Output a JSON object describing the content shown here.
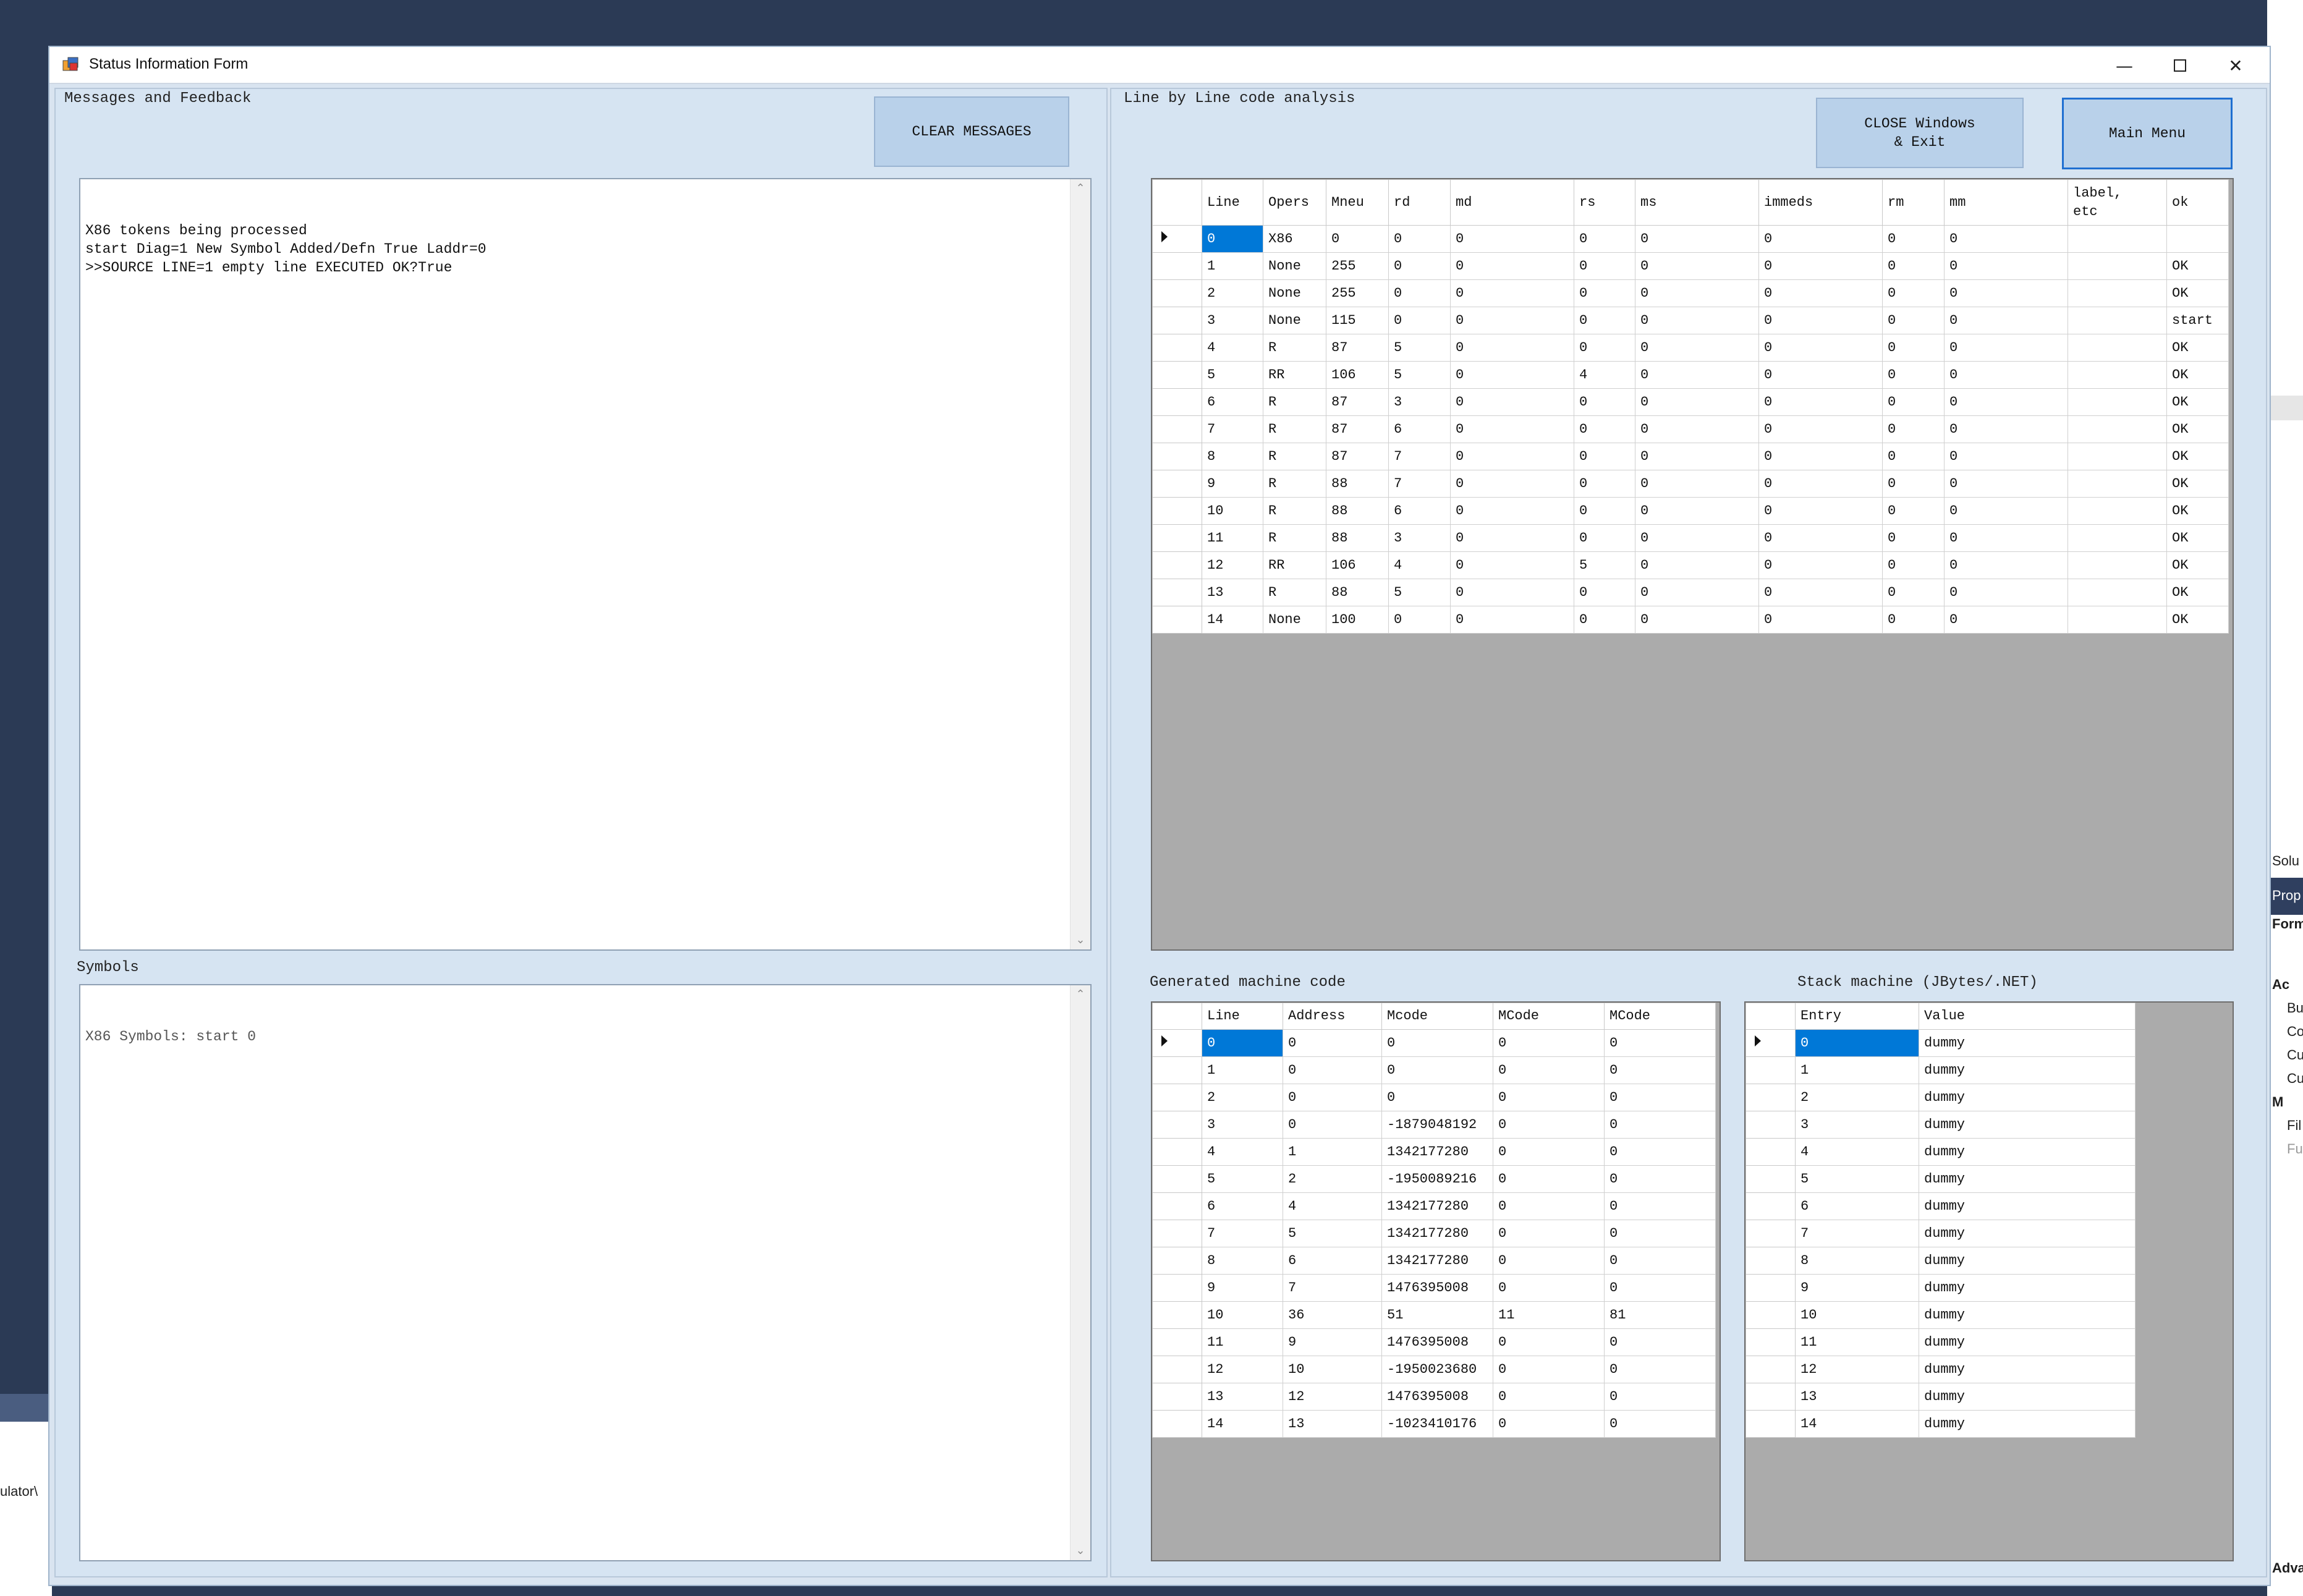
{
  "window": {
    "title": "Status Information Form"
  },
  "desktop": {
    "right_fragments": [
      "Solu",
      "Prop",
      "Form",
      "Ac",
      "Bu",
      "Co",
      "Cu",
      "Cu",
      "M",
      "Fil",
      "Fu",
      "Adva"
    ],
    "left_fragment": "ulator\\"
  },
  "messages": {
    "label": "Messages and Feedback",
    "clear_button": "CLEAR MESSAGES",
    "text": "X86 tokens being processed\nstart Diag=1 New Symbol Added/Defn True Laddr=0\n>>SOURCE LINE=1 empty line EXECUTED OK?True"
  },
  "symbols": {
    "label": "Symbols",
    "text": "X86 Symbols: start 0"
  },
  "analysis": {
    "label": "Line by Line code analysis",
    "close_button": "CLOSE Windows\n& Exit",
    "main_menu_button": "Main Menu",
    "columns": [
      "Line",
      "Opers",
      "Mneu",
      "rd",
      "md",
      "rs",
      "ms",
      "immeds",
      "rm",
      "mm",
      "label,\netc",
      "ok"
    ],
    "rows": [
      [
        "0",
        "X86",
        "0",
        "0",
        "0",
        "0",
        "0",
        "0",
        "0",
        "0",
        "",
        ""
      ],
      [
        "1",
        "None",
        "255",
        "0",
        "0",
        "0",
        "0",
        "0",
        "0",
        "0",
        "",
        "OK"
      ],
      [
        "2",
        "None",
        "255",
        "0",
        "0",
        "0",
        "0",
        "0",
        "0",
        "0",
        "",
        "OK"
      ],
      [
        "3",
        "None",
        "115",
        "0",
        "0",
        "0",
        "0",
        "0",
        "0",
        "0",
        "",
        "start"
      ],
      [
        "4",
        "R",
        "87",
        "5",
        "0",
        "0",
        "0",
        "0",
        "0",
        "0",
        "",
        "OK"
      ],
      [
        "5",
        "RR",
        "106",
        "5",
        "0",
        "4",
        "0",
        "0",
        "0",
        "0",
        "",
        "OK"
      ],
      [
        "6",
        "R",
        "87",
        "3",
        "0",
        "0",
        "0",
        "0",
        "0",
        "0",
        "",
        "OK"
      ],
      [
        "7",
        "R",
        "87",
        "6",
        "0",
        "0",
        "0",
        "0",
        "0",
        "0",
        "",
        "OK"
      ],
      [
        "8",
        "R",
        "87",
        "7",
        "0",
        "0",
        "0",
        "0",
        "0",
        "0",
        "",
        "OK"
      ],
      [
        "9",
        "R",
        "88",
        "7",
        "0",
        "0",
        "0",
        "0",
        "0",
        "0",
        "",
        "OK"
      ],
      [
        "10",
        "R",
        "88",
        "6",
        "0",
        "0",
        "0",
        "0",
        "0",
        "0",
        "",
        "OK"
      ],
      [
        "11",
        "R",
        "88",
        "3",
        "0",
        "0",
        "0",
        "0",
        "0",
        "0",
        "",
        "OK"
      ],
      [
        "12",
        "RR",
        "106",
        "4",
        "0",
        "5",
        "0",
        "0",
        "0",
        "0",
        "",
        "OK"
      ],
      [
        "13",
        "R",
        "88",
        "5",
        "0",
        "0",
        "0",
        "0",
        "0",
        "0",
        "",
        "OK"
      ],
      [
        "14",
        "None",
        "100",
        "0",
        "0",
        "0",
        "0",
        "0",
        "0",
        "0",
        "",
        "OK"
      ]
    ]
  },
  "machine_code": {
    "label": "Generated machine code",
    "columns": [
      "Line",
      "Address",
      "Mcode",
      "MCode",
      "MCode"
    ],
    "rows": [
      [
        "0",
        "0",
        "0",
        "0",
        "0"
      ],
      [
        "1",
        "0",
        "0",
        "0",
        "0"
      ],
      [
        "2",
        "0",
        "0",
        "0",
        "0"
      ],
      [
        "3",
        "0",
        "-1879048192",
        "0",
        "0"
      ],
      [
        "4",
        "1",
        "1342177280",
        "0",
        "0"
      ],
      [
        "5",
        "2",
        "-1950089216",
        "0",
        "0"
      ],
      [
        "6",
        "4",
        "1342177280",
        "0",
        "0"
      ],
      [
        "7",
        "5",
        "1342177280",
        "0",
        "0"
      ],
      [
        "8",
        "6",
        "1342177280",
        "0",
        "0"
      ],
      [
        "9",
        "7",
        "1476395008",
        "0",
        "0"
      ],
      [
        "10",
        "36",
        "51",
        "11",
        "81"
      ],
      [
        "11",
        "9",
        "1476395008",
        "0",
        "0"
      ],
      [
        "12",
        "10",
        "-1950023680",
        "0",
        "0"
      ],
      [
        "13",
        "12",
        "1476395008",
        "0",
        "0"
      ],
      [
        "14",
        "13",
        "-1023410176",
        "0",
        "0"
      ]
    ]
  },
  "stack": {
    "label": "Stack machine (JBytes/.NET)",
    "columns": [
      "Entry",
      "Value"
    ],
    "rows": [
      [
        "0",
        "dummy"
      ],
      [
        "1",
        "dummy"
      ],
      [
        "2",
        "dummy"
      ],
      [
        "3",
        "dummy"
      ],
      [
        "4",
        "dummy"
      ],
      [
        "5",
        "dummy"
      ],
      [
        "6",
        "dummy"
      ],
      [
        "7",
        "dummy"
      ],
      [
        "8",
        "dummy"
      ],
      [
        "9",
        "dummy"
      ],
      [
        "10",
        "dummy"
      ],
      [
        "11",
        "dummy"
      ],
      [
        "12",
        "dummy"
      ],
      [
        "13",
        "dummy"
      ],
      [
        "14",
        "dummy"
      ]
    ]
  },
  "colors": {
    "selection": "#0078d7",
    "panel": "#d6e4f2",
    "button": "#b9d1ea",
    "grid_bg": "#ababab"
  }
}
